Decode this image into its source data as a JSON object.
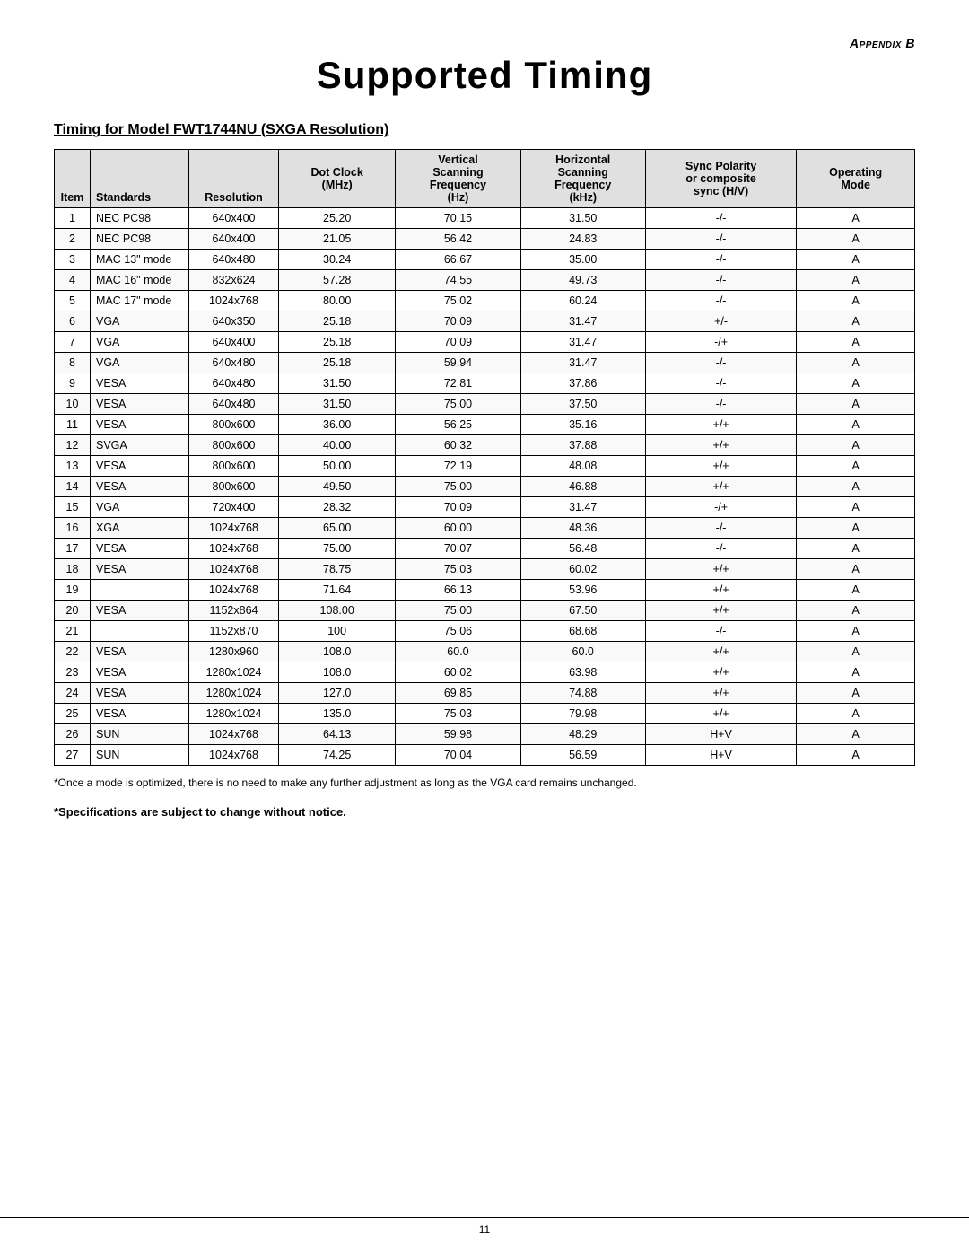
{
  "appendix": {
    "label": "Appendix B",
    "label_prefix": "Appendix",
    "label_suffix": "B"
  },
  "page": {
    "title": "Supported Timing",
    "section_title": "Timing for Model FWT1744NU (SXGA Resolution)",
    "footnote1": "*Once a mode is optimized, there is no need to make any further adjustment as long as the VGA card remains unchanged.",
    "footnote2": "*Specifications are subject to change without notice.",
    "page_number": "11"
  },
  "table": {
    "headers": [
      {
        "label": "Item",
        "sub": ""
      },
      {
        "label": "Standards",
        "sub": ""
      },
      {
        "label": "Resolution",
        "sub": ""
      },
      {
        "label": "Dot Clock",
        "sub": "(MHz)"
      },
      {
        "label": "Vertical Scanning Frequency",
        "sub": "(Hz)"
      },
      {
        "label": "Horizontal Scanning Frequency",
        "sub": "(kHz)"
      },
      {
        "label": "Sync Polarity or composite sync (H/V)",
        "sub": ""
      },
      {
        "label": "Operating Mode",
        "sub": ""
      }
    ],
    "rows": [
      {
        "item": "1",
        "standard": "NEC PC98",
        "resolution": "640x400",
        "dot_clock": "25.20",
        "v_scan": "70.15",
        "h_scan": "31.50",
        "sync": "-/-",
        "mode": "A"
      },
      {
        "item": "2",
        "standard": "NEC PC98",
        "resolution": "640x400",
        "dot_clock": "21.05",
        "v_scan": "56.42",
        "h_scan": "24.83",
        "sync": "-/-",
        "mode": "A"
      },
      {
        "item": "3",
        "standard": "MAC 13\" mode",
        "resolution": "640x480",
        "dot_clock": "30.24",
        "v_scan": "66.67",
        "h_scan": "35.00",
        "sync": "-/-",
        "mode": "A"
      },
      {
        "item": "4",
        "standard": "MAC 16\" mode",
        "resolution": "832x624",
        "dot_clock": "57.28",
        "v_scan": "74.55",
        "h_scan": "49.73",
        "sync": "-/-",
        "mode": "A"
      },
      {
        "item": "5",
        "standard": "MAC 17\" mode",
        "resolution": "1024x768",
        "dot_clock": "80.00",
        "v_scan": "75.02",
        "h_scan": "60.24",
        "sync": "-/-",
        "mode": "A"
      },
      {
        "item": "6",
        "standard": "VGA",
        "resolution": "640x350",
        "dot_clock": "25.18",
        "v_scan": "70.09",
        "h_scan": "31.47",
        "sync": "+/-",
        "mode": "A"
      },
      {
        "item": "7",
        "standard": "VGA",
        "resolution": "640x400",
        "dot_clock": "25.18",
        "v_scan": "70.09",
        "h_scan": "31.47",
        "sync": "-/+",
        "mode": "A"
      },
      {
        "item": "8",
        "standard": "VGA",
        "resolution": "640x480",
        "dot_clock": "25.18",
        "v_scan": "59.94",
        "h_scan": "31.47",
        "sync": "-/-",
        "mode": "A"
      },
      {
        "item": "9",
        "standard": "VESA",
        "resolution": "640x480",
        "dot_clock": "31.50",
        "v_scan": "72.81",
        "h_scan": "37.86",
        "sync": "-/-",
        "mode": "A"
      },
      {
        "item": "10",
        "standard": "VESA",
        "resolution": "640x480",
        "dot_clock": "31.50",
        "v_scan": "75.00",
        "h_scan": "37.50",
        "sync": "-/-",
        "mode": "A"
      },
      {
        "item": "11",
        "standard": "VESA",
        "resolution": "800x600",
        "dot_clock": "36.00",
        "v_scan": "56.25",
        "h_scan": "35.16",
        "sync": "+/+",
        "mode": "A"
      },
      {
        "item": "12",
        "standard": "SVGA",
        "resolution": "800x600",
        "dot_clock": "40.00",
        "v_scan": "60.32",
        "h_scan": "37.88",
        "sync": "+/+",
        "mode": "A"
      },
      {
        "item": "13",
        "standard": "VESA",
        "resolution": "800x600",
        "dot_clock": "50.00",
        "v_scan": "72.19",
        "h_scan": "48.08",
        "sync": "+/+",
        "mode": "A"
      },
      {
        "item": "14",
        "standard": "VESA",
        "resolution": "800x600",
        "dot_clock": "49.50",
        "v_scan": "75.00",
        "h_scan": "46.88",
        "sync": "+/+",
        "mode": "A"
      },
      {
        "item": "15",
        "standard": "VGA",
        "resolution": "720x400",
        "dot_clock": "28.32",
        "v_scan": "70.09",
        "h_scan": "31.47",
        "sync": "-/+",
        "mode": "A"
      },
      {
        "item": "16",
        "standard": "XGA",
        "resolution": "1024x768",
        "dot_clock": "65.00",
        "v_scan": "60.00",
        "h_scan": "48.36",
        "sync": "-/-",
        "mode": "A"
      },
      {
        "item": "17",
        "standard": "VESA",
        "resolution": "1024x768",
        "dot_clock": "75.00",
        "v_scan": "70.07",
        "h_scan": "56.48",
        "sync": "-/-",
        "mode": "A"
      },
      {
        "item": "18",
        "standard": "VESA",
        "resolution": "1024x768",
        "dot_clock": "78.75",
        "v_scan": "75.03",
        "h_scan": "60.02",
        "sync": "+/+",
        "mode": "A"
      },
      {
        "item": "19",
        "standard": "",
        "resolution": "1024x768",
        "dot_clock": "71.64",
        "v_scan": "66.13",
        "h_scan": "53.96",
        "sync": "+/+",
        "mode": "A"
      },
      {
        "item": "20",
        "standard": "VESA",
        "resolution": "1152x864",
        "dot_clock": "108.00",
        "v_scan": "75.00",
        "h_scan": "67.50",
        "sync": "+/+",
        "mode": "A"
      },
      {
        "item": "21",
        "standard": "",
        "resolution": "1152x870",
        "dot_clock": "100",
        "v_scan": "75.06",
        "h_scan": "68.68",
        "sync": "-/-",
        "mode": "A"
      },
      {
        "item": "22",
        "standard": "VESA",
        "resolution": "1280x960",
        "dot_clock": "108.0",
        "v_scan": "60.0",
        "h_scan": "60.0",
        "sync": "+/+",
        "mode": "A"
      },
      {
        "item": "23",
        "standard": "VESA",
        "resolution": "1280x1024",
        "dot_clock": "108.0",
        "v_scan": "60.02",
        "h_scan": "63.98",
        "sync": "+/+",
        "mode": "A"
      },
      {
        "item": "24",
        "standard": "VESA",
        "resolution": "1280x1024",
        "dot_clock": "127.0",
        "v_scan": "69.85",
        "h_scan": "74.88",
        "sync": "+/+",
        "mode": "A"
      },
      {
        "item": "25",
        "standard": "VESA",
        "resolution": "1280x1024",
        "dot_clock": "135.0",
        "v_scan": "75.03",
        "h_scan": "79.98",
        "sync": "+/+",
        "mode": "A"
      },
      {
        "item": "26",
        "standard": "SUN",
        "resolution": "1024x768",
        "dot_clock": "64.13",
        "v_scan": "59.98",
        "h_scan": "48.29",
        "sync": "H+V",
        "mode": "A"
      },
      {
        "item": "27",
        "standard": "SUN",
        "resolution": "1024x768",
        "dot_clock": "74.25",
        "v_scan": "70.04",
        "h_scan": "56.59",
        "sync": "H+V",
        "mode": "A"
      }
    ]
  }
}
